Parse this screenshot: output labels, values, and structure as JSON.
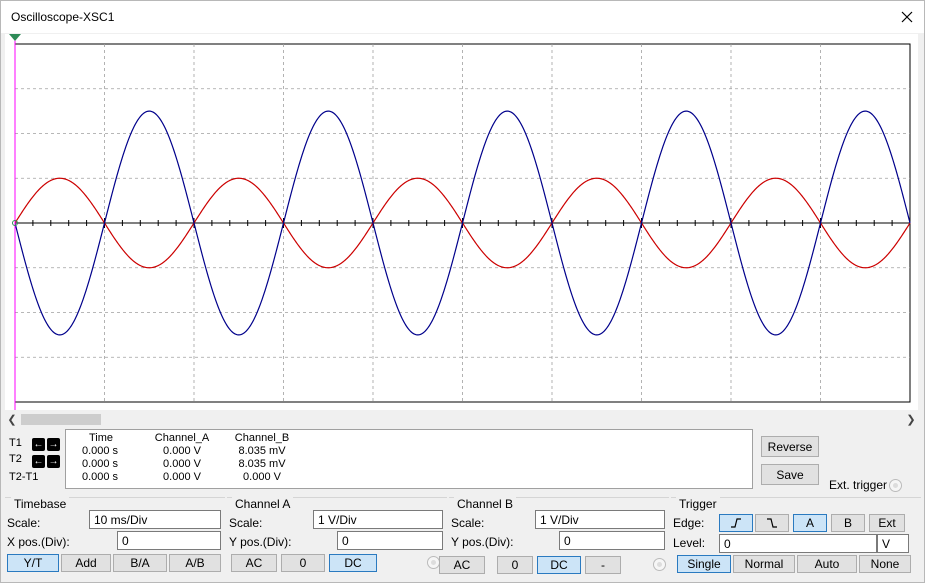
{
  "window": {
    "title": "Oscilloscope-XSC1"
  },
  "readout": {
    "cursors": [
      {
        "label": "T1"
      },
      {
        "label": "T2"
      },
      {
        "label": "T2-T1"
      }
    ],
    "headers": [
      "Time",
      "Channel_A",
      "Channel_B"
    ],
    "rows": [
      [
        "0.000 s",
        "0.000 V",
        "8.035 mV"
      ],
      [
        "0.000 s",
        "0.000 V",
        "8.035 mV"
      ],
      [
        "0.000 s",
        "0.000 V",
        "0.000 V"
      ]
    ]
  },
  "buttons": {
    "reverse": "Reverse",
    "save": "Save",
    "ext_trigger": "Ext. trigger"
  },
  "timebase": {
    "title": "Timebase",
    "scale_label": "Scale:",
    "scale_value": "10 ms/Div",
    "xpos_label": "X pos.(Div):",
    "xpos_value": "0",
    "modes": [
      "Y/T",
      "Add",
      "B/A",
      "A/B"
    ],
    "selected_mode": "Y/T"
  },
  "channel_a": {
    "title": "Channel A",
    "scale_label": "Scale:",
    "scale_value": "1  V/Div",
    "ypos_label": "Y pos.(Div):",
    "ypos_value": "0",
    "coupling": [
      "AC",
      "0",
      "DC"
    ],
    "selected": "DC"
  },
  "channel_b": {
    "title": "Channel B",
    "scale_label": "Scale:",
    "scale_value": "1  V/Div",
    "ypos_label": "Y pos.(Div):",
    "ypos_value": "0",
    "coupling": [
      "AC",
      "0",
      "DC",
      "-"
    ],
    "selected": "DC"
  },
  "trigger": {
    "title": "Trigger",
    "edge_label": "Edge:",
    "sources": [
      "A",
      "B",
      "Ext"
    ],
    "selected_source": "A",
    "level_label": "Level:",
    "level_value": "0",
    "level_unit": "V",
    "modes": [
      "Single",
      "Normal",
      "Auto",
      "None"
    ],
    "selected_mode": "Single"
  },
  "colors": {
    "channel_a": "#cc0000",
    "channel_b": "#00008b",
    "cursor_t1": "#ff00ff",
    "grid": "#a0a0a0"
  },
  "chart_data": {
    "type": "line",
    "x_divisions": 10,
    "y_divisions": 8,
    "series": [
      {
        "id": "channel_a",
        "color": "#cc0000",
        "amplitude_div": 1.0,
        "periods_on_screen": 5,
        "phase": "sin"
      },
      {
        "id": "channel_b",
        "color": "#00008b",
        "amplitude_div": 2.5,
        "periods_on_screen": 5,
        "phase": "-sin"
      }
    ]
  }
}
